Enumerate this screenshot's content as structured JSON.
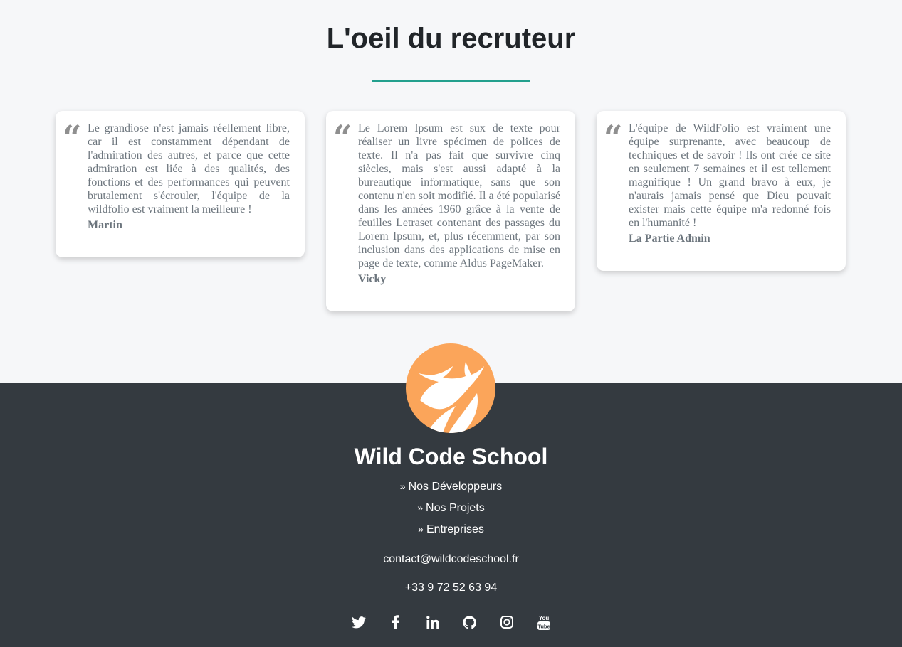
{
  "section": {
    "title": "L'oeil du recruteur"
  },
  "testimonials": [
    {
      "quote_mark": "“",
      "text": "Le grandiose n'est jamais réellement libre, car il est constamment dépendant de l'admiration des autres, et parce que cette admiration est liée à des qualités, des fonctions et des performances qui peuvent brutalement s'écrouler, l'équipe de la wildfolio est vraiment la meilleure !",
      "author": "Martin"
    },
    {
      "quote_mark": "“",
      "text": "Le Lorem Ipsum est sux de texte pour réaliser un livre spécimen de polices de texte. Il n'a pas fait que survivre cinq siècles, mais s'est aussi adapté à la bureautique informatique, sans que son contenu n'en soit modifié. Il a été popularisé dans les années 1960 grâce à la vente de feuilles Letraset contenant des passages du Lorem Ipsum, et, plus récemment, par son inclusion dans des applications de mise en page de texte, comme Aldus PageMaker.",
      "author": "Vicky"
    },
    {
      "quote_mark": "“",
      "text": "L'équipe de WildFolio est vraiment une équipe surprenante, avec beaucoup de techniques et de savoir ! Ils ont crée ce site en seulement 7 semaines et il est tellement magnifique ! Un grand bravo à eux, je n'aurais jamais pensé que Dieu pouvait exister mais cette équipe m'a redonné fois en l'humanité !",
      "author": "La Partie Admin"
    }
  ],
  "footer": {
    "logo_icon": "wild-code-school-deer-logo",
    "brand_name": "Wild Code School",
    "links": [
      {
        "chevron": "»",
        "label": "Nos Développeurs"
      },
      {
        "chevron": "»",
        "label": "Nos Projets"
      },
      {
        "chevron": "»",
        "label": "Entreprises"
      }
    ],
    "email": "contact@wildcodeschool.fr",
    "phone": "+33 9 72 52 63 94",
    "social_icons": [
      "twitter-icon",
      "facebook-icon",
      "linkedin-icon",
      "github-icon",
      "instagram-icon",
      "youtube-icon"
    ],
    "youtube_label_top": "You",
    "youtube_label_bottom": "Tube"
  },
  "colors": {
    "page_bg": "#f6f7f9",
    "accent_rule": "#23a08e",
    "footer_bg": "#343a40",
    "logo_bg": "#fba55a",
    "text_muted": "#6c757d"
  }
}
